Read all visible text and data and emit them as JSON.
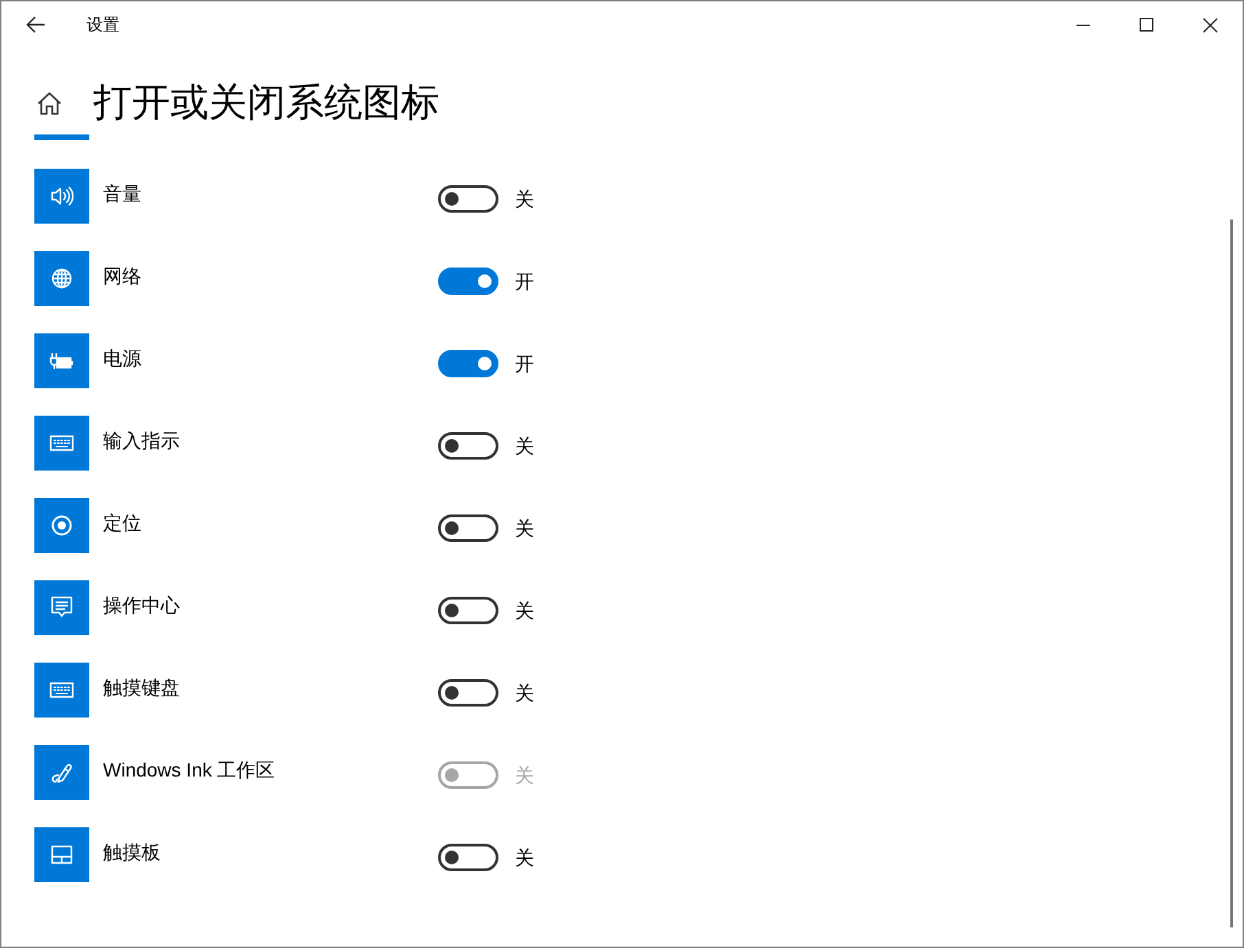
{
  "window": {
    "title": "设置"
  },
  "page": {
    "title": "打开或关闭系统图标"
  },
  "items": [
    {
      "label": "音量",
      "on": false,
      "disabled": false,
      "state_label": "关"
    },
    {
      "label": "网络",
      "on": true,
      "disabled": false,
      "state_label": "开"
    },
    {
      "label": "电源",
      "on": true,
      "disabled": false,
      "state_label": "开"
    },
    {
      "label": "输入指示",
      "on": false,
      "disabled": false,
      "state_label": "关"
    },
    {
      "label": "定位",
      "on": false,
      "disabled": false,
      "state_label": "关"
    },
    {
      "label": "操作中心",
      "on": false,
      "disabled": false,
      "state_label": "关"
    },
    {
      "label": "触摸键盘",
      "on": false,
      "disabled": false,
      "state_label": "关"
    },
    {
      "label": "Windows Ink 工作区",
      "on": false,
      "disabled": true,
      "state_label": "关"
    },
    {
      "label": "触摸板",
      "on": false,
      "disabled": false,
      "state_label": "关"
    }
  ]
}
